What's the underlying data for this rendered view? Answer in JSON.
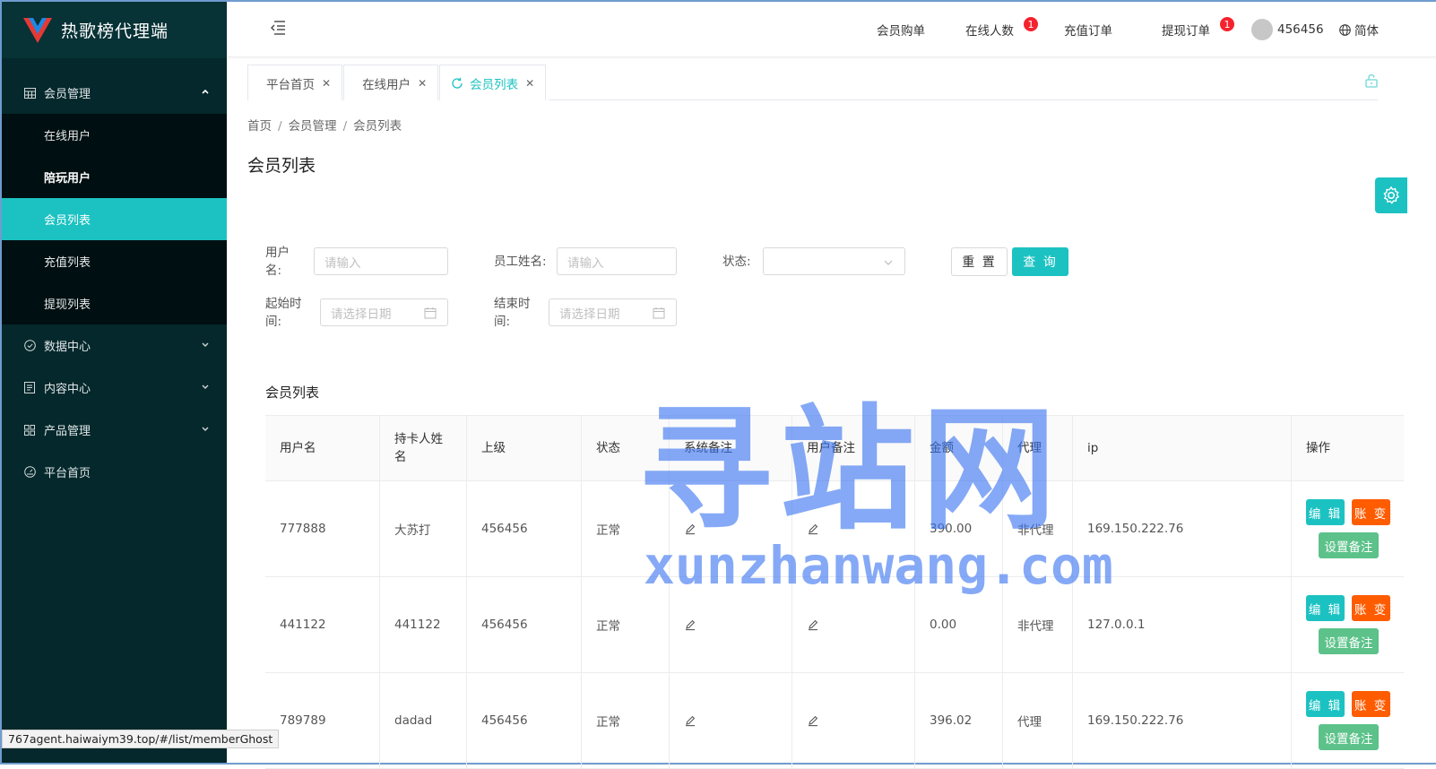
{
  "app": {
    "title": "热歌榜代理端"
  },
  "sidebar": {
    "member_mgmt": "会员管理",
    "sub_items": [
      {
        "label": "在线用户",
        "bold": false,
        "active": false
      },
      {
        "label": "陪玩用户",
        "bold": true,
        "active": false
      },
      {
        "label": "会员列表",
        "bold": false,
        "active": true
      },
      {
        "label": "充值列表",
        "bold": false,
        "active": false
      },
      {
        "label": "提现列表",
        "bold": false,
        "active": false
      }
    ],
    "data_center": "数据中心",
    "content_center": "内容中心",
    "product_mgmt": "产品管理",
    "platform_home": "平台首页"
  },
  "header": {
    "member_purchase": "会员购单",
    "online_count": "在线人数",
    "online_badge": "1",
    "recharge_orders": "充值订单",
    "withdraw_orders": "提现订单",
    "withdraw_badge": "1",
    "username": "456456",
    "language": "简体"
  },
  "tabs": [
    {
      "label": "平台首页",
      "active": false
    },
    {
      "label": "在线用户",
      "active": false
    },
    {
      "label": "会员列表",
      "active": true
    }
  ],
  "breadcrumb": [
    "首页",
    "会员管理",
    "会员列表"
  ],
  "page_title": "会员列表",
  "filters": {
    "username_label_1": "用户",
    "username_label_2": "名:",
    "username_placeholder": "请输入",
    "staff_label": "员工姓名:",
    "staff_placeholder": "请输入",
    "status_label": "状态:",
    "reset_label": "重 置",
    "query_label": "查 询",
    "start_label_1": "起始时",
    "start_label_2": "间:",
    "start_placeholder": "请选择日期",
    "end_label_1": "结束时",
    "end_label_2": "间:",
    "end_placeholder": "请选择日期"
  },
  "table": {
    "title": "会员列表",
    "headers": {
      "username": "用户名",
      "holder_1": "持卡人姓",
      "holder_2": "名",
      "parent": "上级",
      "status": "状态",
      "sys_note": "系统备注",
      "user_note": "用户备注",
      "amount": "金额",
      "agent": "代理",
      "ip": "ip",
      "ops": "操作"
    },
    "rows": [
      {
        "username": "777888",
        "holder": "大苏打",
        "parent": "456456",
        "status": "正常",
        "amount": "390.00",
        "agent": "非代理",
        "ip": "169.150.222.76"
      },
      {
        "username": "441122",
        "holder": "441122",
        "parent": "456456",
        "status": "正常",
        "amount": "0.00",
        "agent": "非代理",
        "ip": "127.0.0.1"
      },
      {
        "username": "789789",
        "holder": "dadad",
        "parent": "456456",
        "status": "正常",
        "amount": "396.02",
        "agent": "代理",
        "ip": "169.150.222.76"
      }
    ],
    "op_edit": "编 辑",
    "op_account": "账 变",
    "op_note": "设置备注"
  },
  "watermark": {
    "main": "寻站网",
    "domain": "xunzhanwang.com"
  },
  "statusbar": {
    "url": "767agent.haiwaiym39.top/#/list/memberGhost"
  },
  "colors": {
    "sidebar_bg": "#04282b",
    "accent": "#1cc2c2",
    "orange": "#ff5c00",
    "green": "#5cc28a",
    "badge": "#f5222d"
  }
}
